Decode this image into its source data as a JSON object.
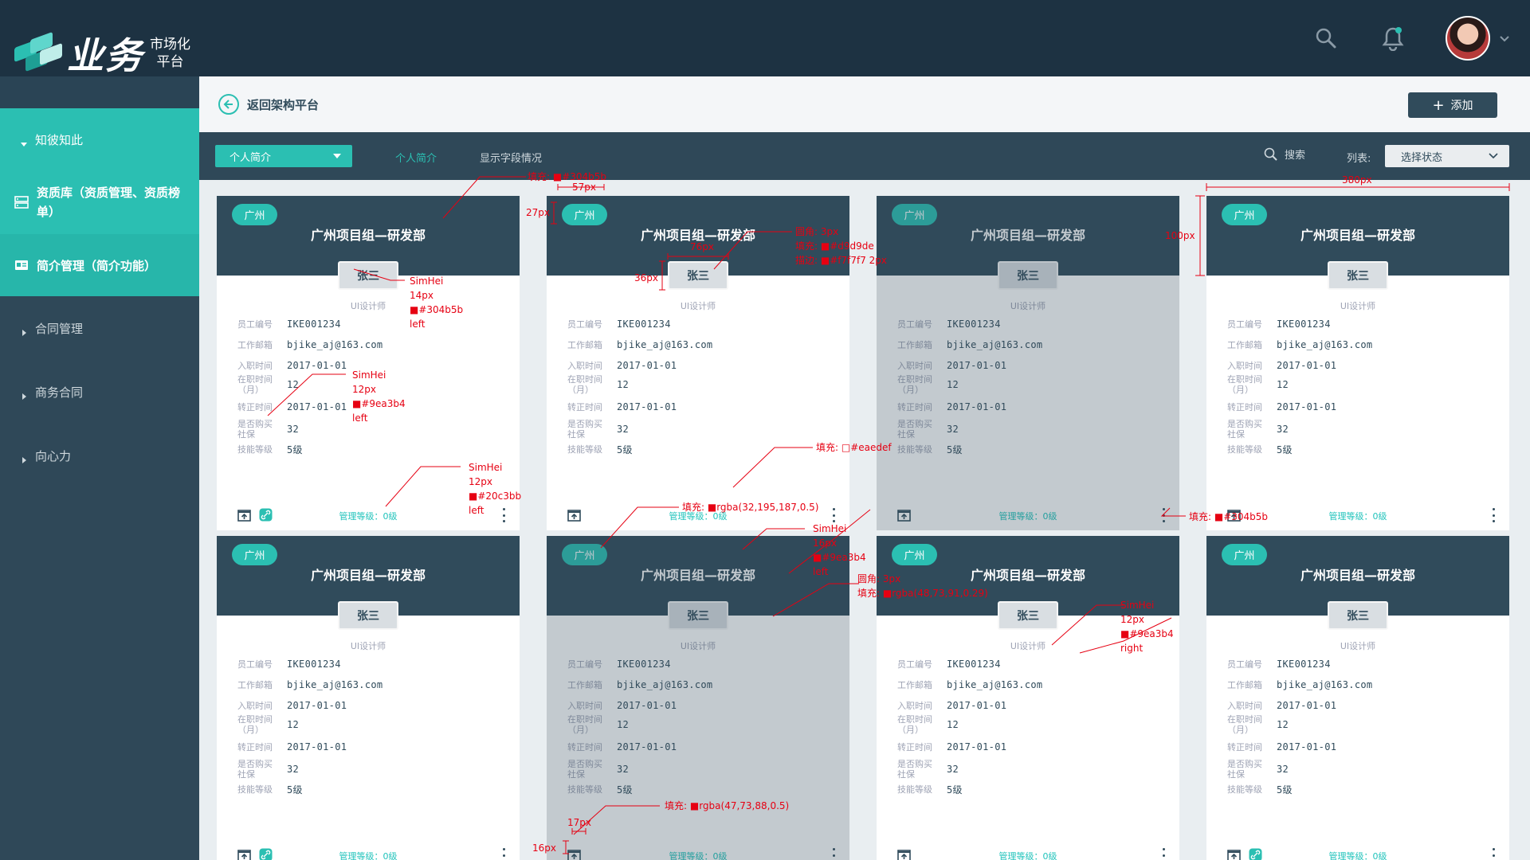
{
  "header": {
    "logo_main": "业务",
    "logo_sub_1": "市场化",
    "logo_sub_2": "平台"
  },
  "sidebar": {
    "items": [
      {
        "label": "知彼知此",
        "icon": "caret-down-icon"
      },
      {
        "label": "资质库（资质管理、资质榜单）",
        "icon": "server-icon"
      },
      {
        "label": "简介管理（简介功能）",
        "icon": "id-card-icon"
      },
      {
        "label": "合同管理",
        "icon": "caret-right-icon"
      },
      {
        "label": "商务合同",
        "icon": "caret-right-icon"
      },
      {
        "label": "向心力",
        "icon": "caret-right-icon"
      }
    ]
  },
  "toolbar": {
    "back_label": "返回架构平台",
    "add_label": "添加"
  },
  "filters": {
    "dropdown_value": "个人简介",
    "tab_active": "个人简介",
    "tab_other": "显示字段情况",
    "search_label": "搜索",
    "list_label": "列表:",
    "status_placeholder": "选择状态"
  },
  "card_labels": {
    "emp_no": "员工编号",
    "email": "工作邮箱",
    "join_date": "入职时间",
    "tenure_1": "在职时间",
    "tenure_2": "（月）",
    "regular": "转正时间",
    "insurance_1": "是否购买",
    "insurance_2": "社保",
    "skill": "技能等级"
  },
  "cards": [
    {
      "city": "广州",
      "title": "广州项目组—研发部",
      "name": "张三",
      "role": "UI设计师",
      "emp_no": "IKE001234",
      "email": "bjike_aj@163.com",
      "join_date": "2017-01-01",
      "tenure": "12",
      "regular": "2017-01-01",
      "insurance": "32",
      "skill": "5级",
      "mgmt": "管理等级：0级",
      "state": "normal",
      "link_icon": true
    },
    {
      "city": "广州",
      "title": "广州项目组—研发部",
      "name": "张三",
      "role": "UI设计师",
      "emp_no": "IKE001234",
      "email": "bjike_aj@163.com",
      "join_date": "2017-01-01",
      "tenure": "12",
      "regular": "2017-01-01",
      "insurance": "32",
      "skill": "5级",
      "mgmt": "管理等级：0级",
      "state": "normal",
      "link_icon": false
    },
    {
      "city": "广州",
      "title": "广州项目组—研发部",
      "name": "张三",
      "role": "UI设计师",
      "emp_no": "IKE001234",
      "email": "bjike_aj@163.com",
      "join_date": "2017-01-01",
      "tenure": "12",
      "regular": "2017-01-01",
      "insurance": "32",
      "skill": "5级",
      "mgmt": "管理等级：0级",
      "state": "disabled",
      "link_icon": false
    },
    {
      "city": "广州",
      "title": "广州项目组—研发部",
      "name": "张三",
      "role": "UI设计师",
      "emp_no": "IKE001234",
      "email": "bjike_aj@163.com",
      "join_date": "2017-01-01",
      "tenure": "12",
      "regular": "2017-01-01",
      "insurance": "32",
      "skill": "5级",
      "mgmt": "管理等级：0级",
      "state": "normal",
      "link_icon": false
    },
    {
      "city": "广州",
      "title": "广州项目组—研发部",
      "name": "张三",
      "role": "UI设计师",
      "emp_no": "IKE001234",
      "email": "bjike_aj@163.com",
      "join_date": "2017-01-01",
      "tenure": "12",
      "regular": "2017-01-01",
      "insurance": "32",
      "skill": "5级",
      "mgmt": "管理等级：0级",
      "state": "normal",
      "link_icon": true
    },
    {
      "city": "广州",
      "title": "广州项目组—研发部",
      "name": "张三",
      "role": "UI设计师",
      "emp_no": "IKE001234",
      "email": "bjike_aj@163.com",
      "join_date": "2017-01-01",
      "tenure": "12",
      "regular": "2017-01-01",
      "insurance": "32",
      "skill": "5级",
      "mgmt": "管理等级：0级",
      "state": "disabled",
      "link_icon": false
    },
    {
      "city": "广州",
      "title": "广州项目组—研发部",
      "name": "张三",
      "role": "UI设计师",
      "emp_no": "IKE001234",
      "email": "bjike_aj@163.com",
      "join_date": "2017-01-01",
      "tenure": "12",
      "regular": "2017-01-01",
      "insurance": "32",
      "skill": "5级",
      "mgmt": "管理等级：0级",
      "state": "normal",
      "link_icon": false
    },
    {
      "city": "广州",
      "title": "广州项目组—研发部",
      "name": "张三",
      "role": "UI设计师",
      "emp_no": "IKE001234",
      "email": "bjike_aj@163.com",
      "join_date": "2017-01-01",
      "tenure": "12",
      "regular": "2017-01-01",
      "insurance": "32",
      "skill": "5级",
      "mgmt": "管理等级：0级",
      "state": "normal",
      "link_icon": true
    }
  ],
  "annotations": [
    {
      "text": "填充: ■#304b5b"
    },
    {
      "text": "57px"
    },
    {
      "text": "27px"
    },
    {
      "text": "380px"
    },
    {
      "text": "100px"
    },
    {
      "text": "76px"
    },
    {
      "text": "36px"
    },
    {
      "text": "圆角: 3px"
    },
    {
      "text": "填充: ■#d9d9de"
    },
    {
      "text": "描边: ■#f7f7f7 2px"
    },
    {
      "text": "SimHei"
    },
    {
      "text": "14px"
    },
    {
      "text": "■#304b5b"
    },
    {
      "text": "left"
    },
    {
      "text": "SimHei"
    },
    {
      "text": "12px"
    },
    {
      "text": "■#9ea3b4"
    },
    {
      "text": "left"
    },
    {
      "text": "SimHei"
    },
    {
      "text": "12px"
    },
    {
      "text": "■#20c3bb"
    },
    {
      "text": "left"
    },
    {
      "text": "填充: □#eaedef"
    },
    {
      "text": "填充: ■rgba(32,195,187,0.5)"
    },
    {
      "text": "填充: ■#304b5b"
    },
    {
      "text": "SimHei"
    },
    {
      "text": "16px"
    },
    {
      "text": "■#9ea3b4"
    },
    {
      "text": "left"
    },
    {
      "text": "圆角: 3px"
    },
    {
      "text": "填充: ■rgba(48,73,91,0.29)"
    },
    {
      "text": "SimHei"
    },
    {
      "text": "12px"
    },
    {
      "text": "■#9ea3b4"
    },
    {
      "text": "right"
    },
    {
      "text": "填充: ■rgba(47,73,88,0.5)"
    },
    {
      "text": "17px"
    },
    {
      "text": "16px"
    }
  ],
  "colors": {
    "accent": "#2bbfb2",
    "dark": "#304b5b",
    "muted": "#9ea3b4",
    "link": "#20c3bb",
    "annotation": "#e60012"
  }
}
